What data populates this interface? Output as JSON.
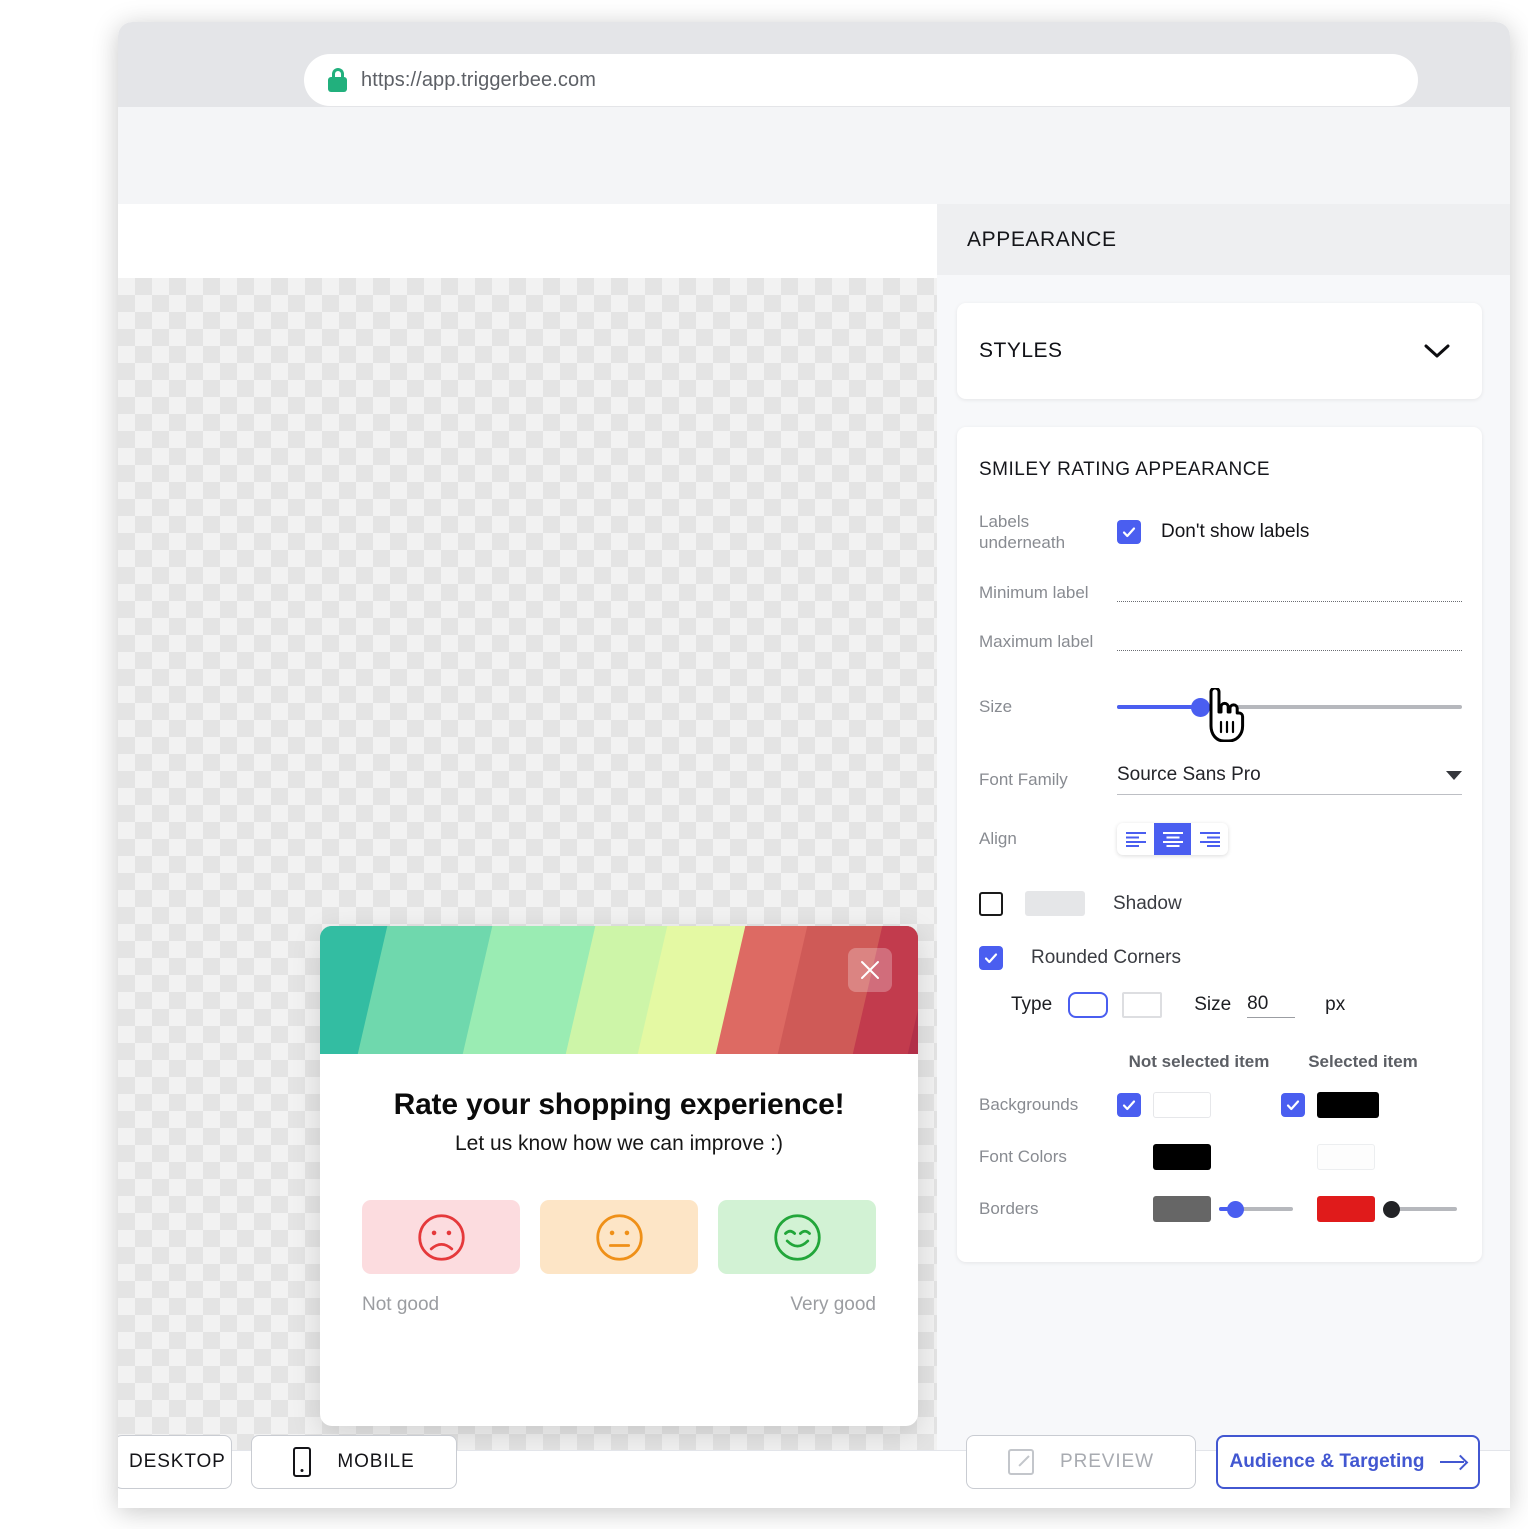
{
  "browser": {
    "url": "https://app.triggerbee.com",
    "lock_icon": "lock-icon"
  },
  "panel": {
    "header_title": "APPEARANCE",
    "styles_card": {
      "label": "STYLES",
      "chevron_icon": "chevron-down-icon"
    },
    "smiley_section": {
      "title": "SMILEY RATING APPEARANCE",
      "labels_underneath": {
        "label": "Labels underneath",
        "checkbox_label": "Don't show labels",
        "checked": true
      },
      "minimum_label": {
        "label": "Minimum label",
        "value": "",
        "placeholder": ""
      },
      "maximum_label": {
        "label": "Maximum label",
        "value": "",
        "placeholder": ""
      },
      "size": {
        "label": "Size",
        "percent": 24
      },
      "font_family": {
        "label": "Font Family",
        "value": "Source Sans Pro",
        "caret_icon": "caret-down-icon"
      },
      "align": {
        "label": "Align",
        "options": [
          "align-left-icon",
          "align-center-icon",
          "align-right-icon"
        ],
        "selected_index": 1
      },
      "shadow": {
        "label": "Shadow",
        "checked": false,
        "color": "#e5e6e8"
      },
      "rounded_corners": {
        "label": "Rounded Corners",
        "checked": true,
        "type_label": "Type",
        "type_selected_index": 0,
        "size_label": "Size",
        "size_value": "80",
        "unit_label": "px"
      },
      "columns": {
        "not_selected": "Not selected item",
        "selected": "Selected item"
      },
      "backgrounds": {
        "label": "Backgrounds",
        "not_selected": {
          "checked": true,
          "color": "#ffffff"
        },
        "selected": {
          "checked": true,
          "color": "#000000"
        }
      },
      "font_colors": {
        "label": "Font Colors",
        "not_selected_color": "#000000",
        "selected_color": "#fdfdfd"
      },
      "borders": {
        "label": "Borders",
        "not_selected": {
          "color": "#666666",
          "width_percent": 22
        },
        "selected": {
          "color": "#e01b1b",
          "width_percent": 3
        }
      }
    }
  },
  "preview": {
    "close_icon": "close-icon",
    "title": "Rate your shopping experience!",
    "subtitle": "Let us know how we can improve :)",
    "banner_colors": [
      "#33bda2",
      "#6fd8ad",
      "#9aecb3",
      "#cdf5a8",
      "#e4f9a3",
      "#dd6a63",
      "#cf5a57",
      "#c23b4d",
      "#b13049"
    ],
    "smileys": [
      {
        "name": "sad-face-icon",
        "mood": "sad",
        "bg": "#fcdcdf",
        "color": "#e5393b"
      },
      {
        "name": "neutral-face-icon",
        "mood": "neutral",
        "bg": "#fde5c6",
        "color": "#ef9018"
      },
      {
        "name": "happy-face-icon",
        "mood": "happy",
        "bg": "#d2f2d4",
        "color": "#22a63a"
      }
    ],
    "min_label": "Not good",
    "max_label": "Very good"
  },
  "bottom_bar": {
    "desktop": {
      "label": "DESKTOP",
      "icon": "desktop-icon"
    },
    "mobile": {
      "label": "MOBILE",
      "icon": "mobile-icon"
    },
    "preview": {
      "label": "PREVIEW",
      "icon": "external-link-icon"
    },
    "audience": {
      "label": "Audience & Targeting",
      "icon": "arrow-right-icon"
    }
  },
  "cursor": {
    "icon": "pointing-hand-cursor"
  },
  "colors": {
    "accent": "#4a5ef0",
    "link": "#4257d1"
  }
}
